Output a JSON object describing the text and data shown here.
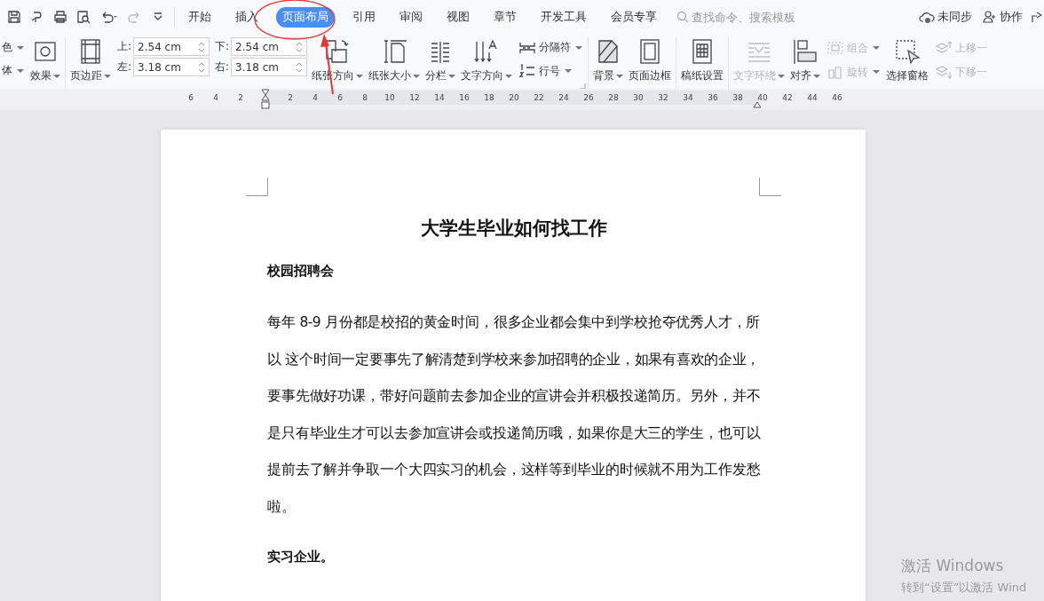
{
  "tabs": [
    {
      "label": "开始",
      "selected": false
    },
    {
      "label": "插入",
      "selected": false
    },
    {
      "label": "页面布局",
      "selected": true
    },
    {
      "label": "引用",
      "selected": false
    },
    {
      "label": "审阅",
      "selected": false
    },
    {
      "label": "视图",
      "selected": false
    },
    {
      "label": "章节",
      "selected": false
    },
    {
      "label": "开发工具",
      "selected": false
    },
    {
      "label": "会员专享",
      "selected": false
    }
  ],
  "search": {
    "placeholder": "查找命令、搜索模板"
  },
  "account": [
    {
      "label": "未同步"
    },
    {
      "label": "协作"
    }
  ],
  "ribbon": [
    [
      {
        "kind": "stack",
        "items": [
          {
            "label": "色",
            "dropdown": true,
            "disabled": false
          },
          {
            "label": "体",
            "dropdown": true,
            "disabled": false
          }
        ]
      },
      {
        "kind": "big",
        "label": "效果",
        "dropdown": true,
        "disabled": false
      }
    ],
    [
      {
        "kind": "big",
        "label": "页边距",
        "dropdown": true,
        "disabled": false
      },
      {
        "kind": "margins",
        "fields": [
          {
            "label": "上:",
            "value": "2.54 cm"
          },
          {
            "label": "下:",
            "value": "2.54 cm"
          },
          {
            "label": "左:",
            "value": "3.18 cm"
          },
          {
            "label": "右:",
            "value": "3.18 cm"
          }
        ]
      },
      {
        "kind": "big",
        "label": "纸张方向",
        "dropdown": true,
        "disabled": false
      },
      {
        "kind": "big",
        "label": "纸张大小",
        "dropdown": true,
        "disabled": false
      },
      {
        "kind": "big",
        "label": "分栏",
        "dropdown": true,
        "disabled": false
      },
      {
        "kind": "big",
        "label": "文字方向",
        "dropdown": true,
        "disabled": false
      },
      {
        "kind": "stack",
        "items": [
          {
            "label": "分隔符",
            "dropdown": true,
            "disabled": false
          },
          {
            "label": "行号",
            "dropdown": true,
            "disabled": false
          }
        ]
      }
    ],
    [
      {
        "kind": "big",
        "label": "背景",
        "dropdown": true,
        "disabled": false
      },
      {
        "kind": "big",
        "label": "页面边框",
        "dropdown": false,
        "disabled": false
      }
    ],
    [
      {
        "kind": "big",
        "label": "稿纸设置",
        "dropdown": false,
        "disabled": false
      }
    ],
    [
      {
        "kind": "big",
        "label": "文字环绕",
        "dropdown": true,
        "disabled": true
      },
      {
        "kind": "big",
        "label": "对齐",
        "dropdown": true,
        "disabled": false
      },
      {
        "kind": "stack",
        "items": [
          {
            "label": "组合",
            "dropdown": true,
            "disabled": true
          },
          {
            "label": "旋转",
            "dropdown": true,
            "disabled": true
          }
        ]
      },
      {
        "kind": "big",
        "label": "选择窗格",
        "dropdown": false,
        "disabled": false
      },
      {
        "kind": "stack",
        "items": [
          {
            "label": "上移一",
            "dropdown": false,
            "disabled": true
          },
          {
            "label": "下移一",
            "dropdown": false,
            "disabled": true
          }
        ]
      }
    ]
  ],
  "ruler": {
    "left_numbers": [
      "6",
      "4",
      "2"
    ],
    "numbers": [
      "2",
      "4",
      "6",
      "8",
      "10",
      "12",
      "14",
      "16",
      "18",
      "20",
      "22",
      "24",
      "26",
      "28",
      "30",
      "32",
      "34",
      "36",
      "38",
      "40",
      "42",
      "44",
      "46"
    ]
  },
  "document": {
    "title": "大学生毕业如何找工作",
    "blocks": [
      {
        "kind": "heading",
        "text": "校园招聘会"
      },
      {
        "kind": "paragraph",
        "text": "每年 8-9 月份都是校招的黄金时间，很多企业都会集中到学校抢夺优秀人才，所以 这个时间一定要事先了解清楚到学校来参加招聘的企业，如果有喜欢的企业，要事先做好功课，带好问题前去参加企业的宣讲会并积极投递简历。另外，并不是只有毕业生才可以去参加宣讲会或投递简历哦，如果你是大三的学生，也可以提前去了解并争取一个大四实习的机会，这样等到毕业的时候就不用为工作发愁啦。"
      },
      {
        "kind": "heading",
        "text": "实习企业。"
      }
    ]
  },
  "activation": {
    "title": "激活 Windows",
    "hint": "转到“设置”以激活 Wind"
  }
}
